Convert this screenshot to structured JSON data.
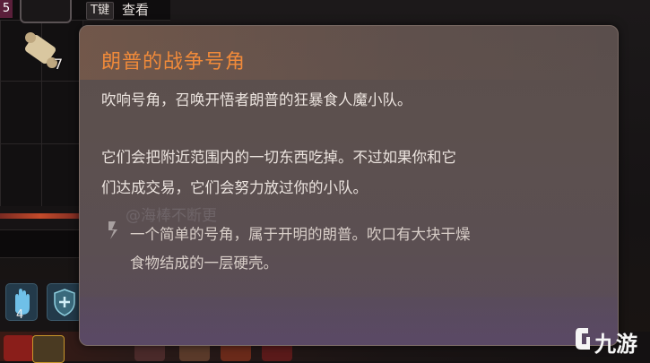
{
  "topbar": {
    "slot_number": "5",
    "key_hint": "T键",
    "view_label": "查看"
  },
  "inventory": {
    "scroll_count": "7"
  },
  "hotbar": {
    "slot1_count": "4"
  },
  "tooltip": {
    "title": "朗普的战争号角",
    "description": "吹响号角，召唤开悟者朗普的狂暴食人魔小队。",
    "effect_line1": "它们会把附近范围内的一切东西吃掉。不过如果你和它",
    "effect_line2": "们达成交易，它们会努力放过你的小队。",
    "flavor_line1": "一个简单的号角，属于开明的朗普。吹口有大块干燥",
    "flavor_line2": "食物结成的一层硬壳。"
  },
  "watermark": "@海棒不断更",
  "logo": {
    "text": "九游"
  },
  "colors": {
    "title_orange": "#f08a3a",
    "text_light": "#ece4df",
    "tooltip_bg": "#5c504e"
  }
}
